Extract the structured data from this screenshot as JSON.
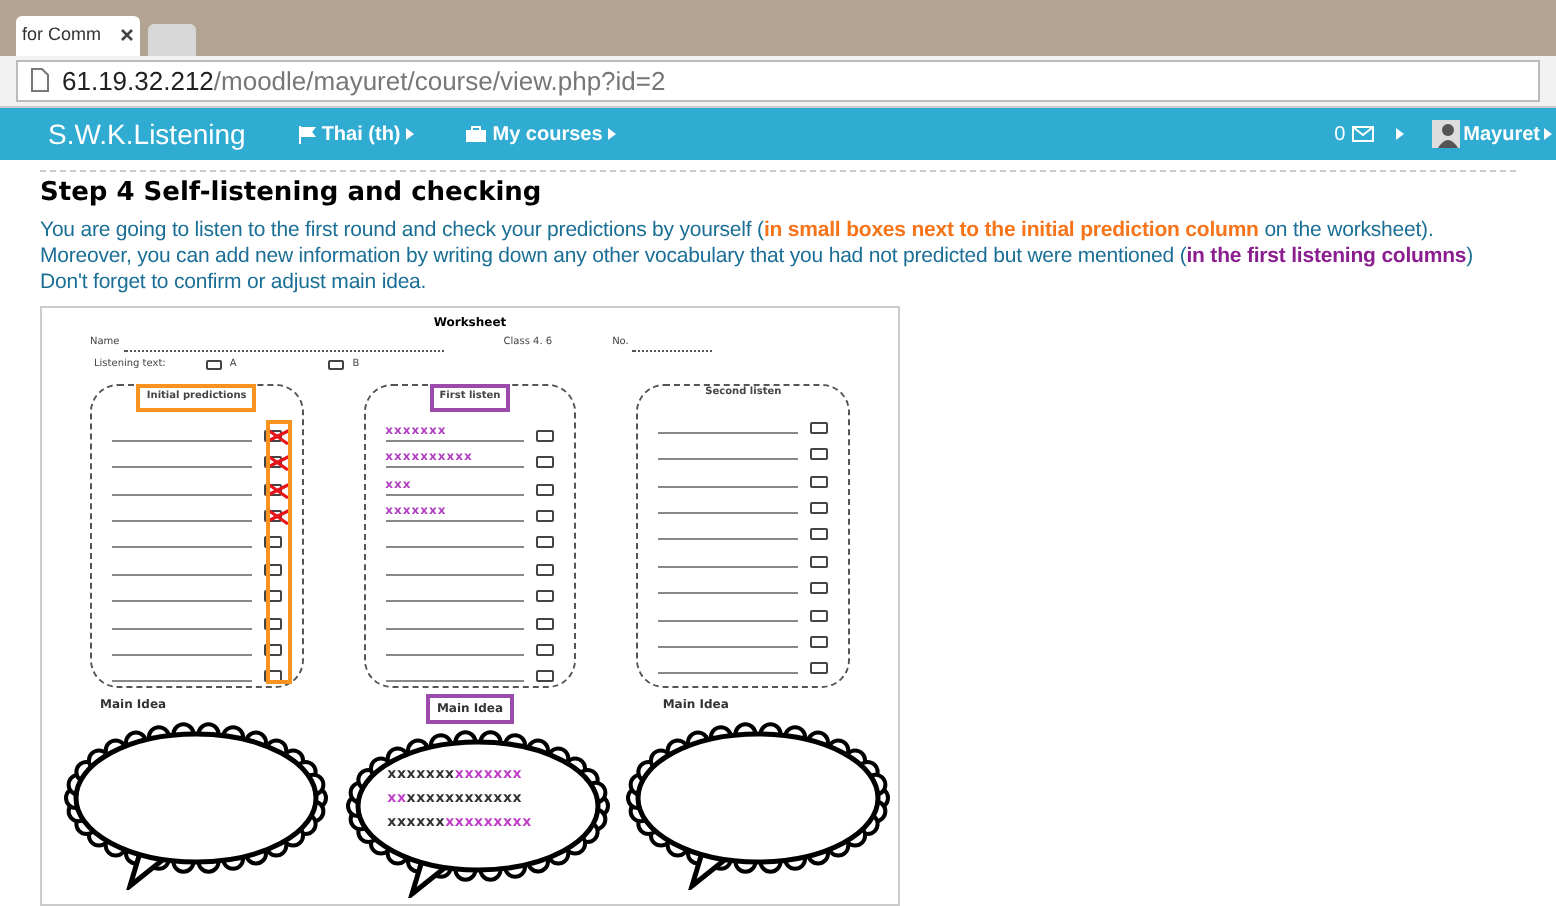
{
  "browser": {
    "tabs": [
      {
        "title": "for Comm",
        "selected": true
      },
      {
        "selected": false
      }
    ],
    "url_host": "61.19.32.212",
    "url_path": "/moodle/mayuret/course/view.php?id=2"
  },
  "navbar": {
    "brand": "S.W.K.Listening",
    "menus": [
      {
        "kind": "flag",
        "label": "Thai (th)"
      },
      {
        "kind": "briefcase",
        "label": "My courses"
      }
    ],
    "message_count": "0",
    "user": "Mayuret"
  },
  "section": {
    "heading": "Step 4 Self-listening and checking",
    "lines": [
      [
        {
          "kind": "plain",
          "text": "You are going to listen to the first round and check your predictions by yourself ("
        },
        {
          "kind": "orange",
          "text": "in small boxes next to the initial prediction column"
        },
        {
          "kind": "plain",
          "text": " on the worksheet)."
        }
      ],
      [
        {
          "kind": "plain",
          "text": "Moreover, you can add new information by writing down any other vocabulary that you had not predicted but were mentioned ("
        },
        {
          "kind": "purple",
          "text": "in the first listening columns"
        },
        {
          "kind": "plain",
          "text": ")"
        }
      ],
      [
        {
          "kind": "plain",
          "text": "Don't forget to confirm or adjust main idea."
        }
      ]
    ]
  },
  "worksheet": {
    "title": "Worksheet",
    "name_label": "Name",
    "class_label": "Class 4. 6",
    "no_label": "No.",
    "listening_label": "Listening text:",
    "options": [
      {
        "label": "A",
        "checked": false
      },
      {
        "label": "B",
        "checked": false
      }
    ],
    "columns": [
      {
        "heading": "Initial predictions",
        "color": "#f7931e",
        "rows": [
          {
            "text": "",
            "marked": true
          },
          {
            "text": "",
            "marked": true
          },
          {
            "text": "",
            "marked": true
          },
          {
            "text": "",
            "marked": true
          },
          {
            "text": "",
            "marked": false
          },
          {
            "text": "",
            "marked": false
          },
          {
            "text": "",
            "marked": false
          },
          {
            "text": "",
            "marked": false
          },
          {
            "text": "",
            "marked": false
          },
          {
            "text": "",
            "marked": false
          }
        ]
      },
      {
        "heading": "First listen",
        "color": "#9b4bab",
        "rows": [
          {
            "text": "xxxxxxx",
            "marked": false
          },
          {
            "text": "xxxxxxxxxx",
            "marked": false
          },
          {
            "text": "xxx",
            "marked": false
          },
          {
            "text": "xxxxxxx",
            "marked": false
          },
          {
            "text": "",
            "marked": false
          },
          {
            "text": "",
            "marked": false
          },
          {
            "text": "",
            "marked": false
          },
          {
            "text": "",
            "marked": false
          },
          {
            "text": "",
            "marked": false
          },
          {
            "text": "",
            "marked": false
          }
        ]
      },
      {
        "heading": "Second listen",
        "rows": [
          {
            "text": "",
            "marked": false
          },
          {
            "text": "",
            "marked": false
          },
          {
            "text": "",
            "marked": false
          },
          {
            "text": "",
            "marked": false
          },
          {
            "text": "",
            "marked": false
          },
          {
            "text": "",
            "marked": false
          },
          {
            "text": "",
            "marked": false
          },
          {
            "text": "",
            "marked": false
          },
          {
            "text": "",
            "marked": false
          },
          {
            "text": "",
            "marked": false
          }
        ]
      }
    ],
    "main_ideas": [
      {
        "label": "Main Idea"
      },
      {
        "label": "Main Idea",
        "color": "#9b4bab",
        "lines": [
          [
            {
              "kind": "original",
              "text": "xxxxxxx"
            },
            {
              "kind": "added",
              "text": "xxxxxxx"
            }
          ],
          [
            {
              "kind": "added",
              "text": "xx"
            },
            {
              "kind": "original",
              "text": "xxxxxxxxxxxx"
            }
          ],
          [
            {
              "kind": "original",
              "text": "xxxxxx"
            },
            {
              "kind": "added",
              "text": "xxxxxxxxx"
            }
          ]
        ]
      },
      {
        "label": "Main Idea"
      }
    ]
  }
}
